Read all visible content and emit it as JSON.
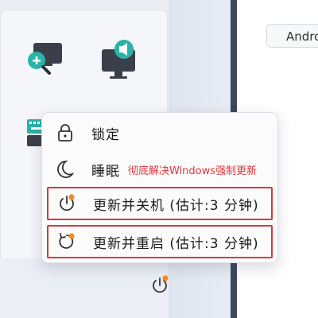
{
  "backdrop": {
    "window_chip_text": "Andro"
  },
  "context_menu": {
    "items": [
      {
        "label": "锁定",
        "icon": "lock-icon"
      },
      {
        "label": "睡眠",
        "icon": "moon-icon"
      },
      {
        "label": "更新并关机 (估计:3 分钟)",
        "icon": "update-shutdown-icon"
      },
      {
        "label": "更新并重启 (估计:3 分钟)",
        "icon": "update-restart-icon"
      }
    ],
    "annotation": "彻底解决Windows强制更新"
  },
  "colors": {
    "highlight_border": "#d23b3b",
    "annotation_text": "#e0353a",
    "update_dot": "#f08a24",
    "tile_accent": "#2bb3a8"
  }
}
